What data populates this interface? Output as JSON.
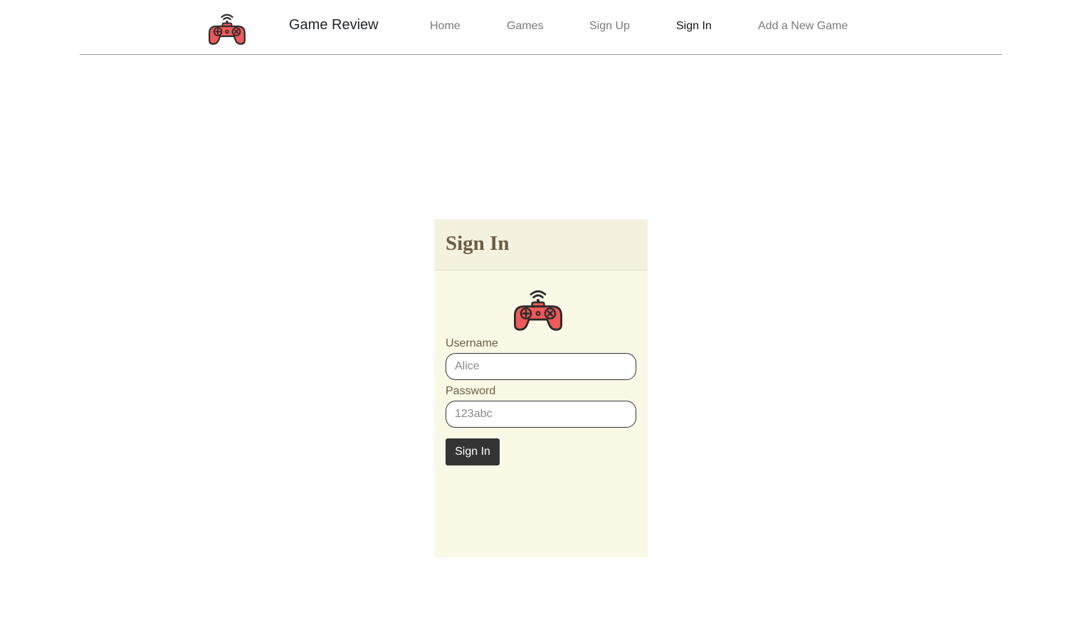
{
  "nav": {
    "logo_icon": "gamepad-icon",
    "brand": "Game Review",
    "links": [
      {
        "label": "Home",
        "active": false
      },
      {
        "label": "Games",
        "active": false
      },
      {
        "label": "Sign Up",
        "active": false
      },
      {
        "label": "Sign In",
        "active": true
      },
      {
        "label": "Add a New Game",
        "active": false
      }
    ]
  },
  "signin": {
    "title": "Sign In",
    "logo_icon": "gamepad-icon",
    "username": {
      "label": "Username",
      "placeholder": "Alice",
      "value": ""
    },
    "password": {
      "label": "Password",
      "placeholder": "123abc",
      "value": ""
    },
    "submit_label": "Sign In"
  },
  "colors": {
    "card_bg": "#faf9e6",
    "card_header_bg": "#f4f2df",
    "title_text": "#6b5b45",
    "button_bg": "#343434",
    "gamepad_red": "#f05a5a",
    "nav_link": "#7a7a7a",
    "nav_link_active": "#111111"
  }
}
